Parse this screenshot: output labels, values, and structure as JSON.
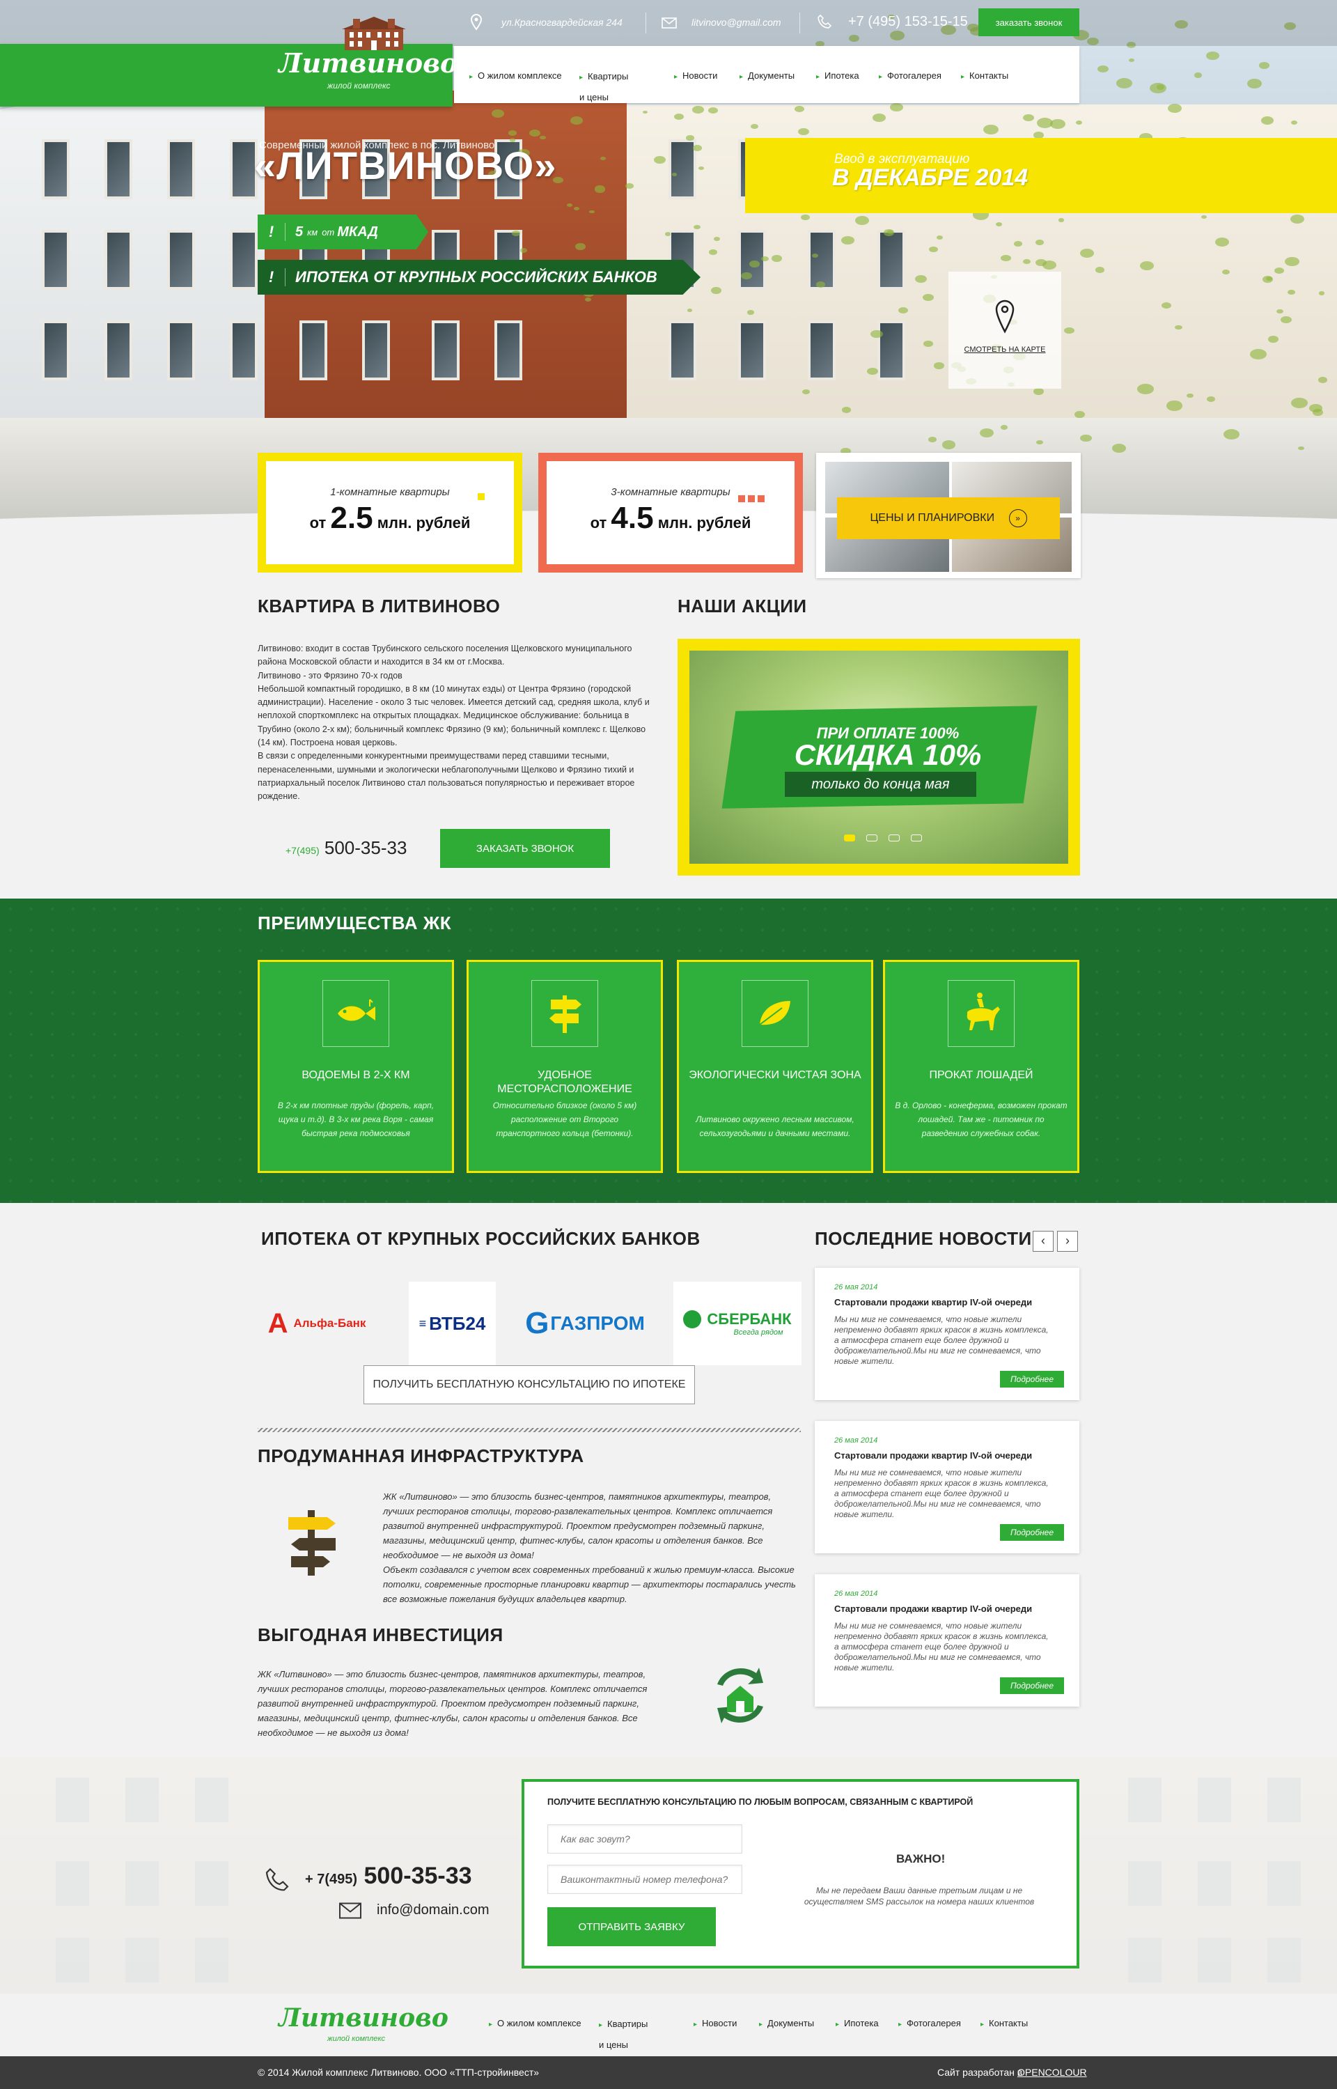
{
  "topbar": {
    "address": "ул.Красногвардейская 244",
    "email": "litvinovo@gmail.com",
    "phone": "+7 (495) 153-15-15",
    "call_button": "заказать звонок"
  },
  "logo": {
    "title": "Литвиново",
    "subtitle": "жилой комплекс"
  },
  "nav": [
    {
      "label": "О жилом комплексе"
    },
    {
      "label": "Квартиры и цены"
    },
    {
      "label": "Новости"
    },
    {
      "label": "Документы"
    },
    {
      "label": "Ипотека"
    },
    {
      "label": "Фотогалерея"
    },
    {
      "label": "Контакты"
    }
  ],
  "hero": {
    "subtitle": "Современный жилой комплекс в пос. Литвиново",
    "title": "«ЛИТВИНОВО»",
    "ribbon1": {
      "icon": "!",
      "num": "5",
      "km": "км",
      "ot": "от",
      "label": "МКАД"
    },
    "ribbon2": {
      "icon": "!",
      "label": "ИПОТЕКА ОТ КРУПНЫХ РОССИЙСКИХ БАНКОВ"
    },
    "commission_label": "Ввод в эксплуатацию",
    "commission_value": "В ДЕКАБРЕ 2014",
    "map_link": "СМОТРЕТЬ НА КАРТЕ"
  },
  "prices": [
    {
      "label": "1-комнатные квартиры",
      "from": "от",
      "value": "2.5",
      "unit": "млн. рублей",
      "accent": "#f7e400"
    },
    {
      "label": "3-комнатные квартиры",
      "from": "от",
      "value": "4.5",
      "unit": "млн. рублей",
      "accent": "#ef6a4f"
    }
  ],
  "plans_button": "ЦЕНЫ И ПЛАНИРОВКИ",
  "about": {
    "heading": "КВАРТИРА В ЛИТВИНОВО",
    "paragraphs": [
      "Литвиново: входит в состав Трубинского сельского поселения Щелковского муниципального района Московской области и находится в 34 км от г.Москва.",
      "Литвиново - это Фрязино 70-х годов",
      "Небольшой компактный городишко, в 8 км (10 минутах езды) от Центра Фрязино (городской администрации). Население - около 3 тыс человек. Имеется детский сад, средняя школа, клуб и неплохой спорткомплекс на открытых площадках. Медицинское обслуживание: больница в Трубино (около 2-х км); больничный комплекс Фрязино (9 км); больничный комплекс г. Щелково (14 км). Построена новая церковь.",
      "В связи с определенными конкурентными преимуществами перед ставшими тесными, перенаселенными, шумными и экологически неблагополучными Щелково и Фрязино тихий и патриархальный поселок Литвиново стал пользоваться популярностью и переживает второе рождение."
    ],
    "phone_prefix": "+7(495)",
    "phone": "500-35-33",
    "call_button": "ЗАКАЗАТЬ ЗВОНОК"
  },
  "promo": {
    "heading": "НАШИ АКЦИИ",
    "line1": "ПРИ ОПЛАТЕ 100%",
    "line2": "СКИДКА 10%",
    "line3": "только до конца мая"
  },
  "advantages": {
    "heading": "ПРЕИМУЩЕСТВА ЖК",
    "items": [
      {
        "title": "ВОДОЕМЫ В 2-Х КМ",
        "text": "В 2-х км плотные пруды (форель, карп, щука и т.д). В 3-х км река Воря - самая быстрая река подмосковья",
        "icon": "fish-icon"
      },
      {
        "title": "УДОБНОЕ МЕСТОРАСПОЛОЖЕНИЕ",
        "text": "Относительно близкое (около 5 км) расположение от Второго транспортного кольца (бетонки).",
        "icon": "signpost-icon"
      },
      {
        "title": "ЭКОЛОГИЧЕСКИ ЧИСТАЯ ЗОНА",
        "text": "Литвиново окружено лесным массивом, сельхозугодьями и дачными местами.",
        "icon": "leaf-icon"
      },
      {
        "title": "ПРОКАТ ЛОШАДЕЙ",
        "text": "В д. Орлово - конеферма, возможен прокат лошадей. Там же - питомник по разведению служебных собак.",
        "icon": "horse-rider-icon"
      }
    ]
  },
  "mortgage": {
    "heading": "ИПОТЕКА ОТ КРУПНЫХ РОССИЙСКИХ БАНКОВ",
    "banks": [
      {
        "name": "Альфа-Банк",
        "icon": "alfa-bank-logo"
      },
      {
        "name": "ВТБ24",
        "icon": "vtb24-logo"
      },
      {
        "name": "ГАЗПРОМ",
        "icon": "gazprom-logo"
      },
      {
        "name": "СБЕРБАНК",
        "tagline": "Всегда рядом",
        "icon": "sberbank-logo"
      }
    ],
    "consult_button": "ПОЛУЧИТЬ БЕСПЛАТНУЮ КОНСУЛЬТАЦИЮ ПО ИПОТЕКЕ"
  },
  "infrastructure": {
    "heading": "ПРОДУМАННАЯ ИНФРАСТРУКТУРА",
    "text": "ЖК «Литвиново» — это близость бизнес-центров, памятников архитектуры, театров, лучших ресторанов столицы, торгово-развлекательных центров. Комплекс отличается развитой внутренней инфраструктурой. Проектом предусмотрен подземный паркинг, магазины, медицинский центр, фитнес-клубы, салон красоты и отделения банков. Все необходимое — не выходя из дома!",
    "text2": "Объект создавался с учетом всех современных требований к жилью премиум-класса. Высокие потолки, современные просторные планировки квартир — архитекторы постарались учесть все возможные пожелания будущих владельцев квартир."
  },
  "investment": {
    "heading": "ВЫГОДНАЯ ИНВЕСТИЦИЯ",
    "text": "ЖК «Литвиново» — это близость бизнес-центров, памятников архитектуры, театров, лучших ресторанов столицы, торгово-развлекательных центров. Комплекс отличается развитой внутренней инфраструктурой. Проектом предусмотрен подземный паркинг, магазины, медицинский центр, фитнес-клубы, салон красоты и отделения банков. Все необходимое — не выходя из дома!"
  },
  "news": {
    "heading": "ПОСЛЕДНИЕ НОВОСТИ",
    "prev": "‹",
    "next": "›",
    "items": [
      {
        "date": "26 мая 2014",
        "title": "Стартовали продажи квартир IV-ой очереди",
        "body": "Мы ни миг не сомневаемся, что новые жители непременно добавят ярких красок в жизнь комплекса, а атмосфера станет еще более дружной и доброжелательной.Мы ни миг не сомневаемся, что новые жители.",
        "more": "Подробнее"
      },
      {
        "date": "26 мая 2014",
        "title": "Стартовали продажи квартир IV-ой очереди",
        "body": "Мы ни миг не сомневаемся, что новые жители непременно добавят ярких красок в жизнь комплекса, а атмосфера станет еще более дружной и доброжелательной.Мы ни миг не сомневаемся, что новые жители.",
        "more": "Подробнее"
      },
      {
        "date": "26 мая 2014",
        "title": "Стартовали продажи квартир IV-ой очереди",
        "body": "Мы ни миг не сомневаемся, что новые жители непременно добавят ярких красок в жизнь комплекса, а атмосфера станет еще более дружной и доброжелательной.Мы ни миг не сомневаемся, что новые жители.",
        "more": "Подробнее"
      }
    ]
  },
  "contact": {
    "phone_prefix": "+ 7(495)",
    "phone": "500-35-33",
    "email": "info@domain.com",
    "form_title": "ПОЛУЧИТЕ БЕСПЛАТНУЮ КОНСУЛЬТАЦИЮ ПО ЛЮБЫМ ВОПРОСАМ, СВЯЗАННЫМ С КВАРТИРОЙ",
    "name_placeholder": "Как вас зовут?",
    "phone_placeholder": "Вашконтактный номер телефона?",
    "submit": "ОТПРАВИТЬ ЗАЯВКУ",
    "important_title": "ВАЖНО!",
    "important_text": "Мы не передаем Ваши данные третьим лицам и не осуществляем SMS рассылок на номера наших клиентов"
  },
  "footer": {
    "copyright": "© 2014 Жилой комплекс Литвиново. ООО «ТТП-стройинвест»",
    "credit_label": "Сайт разработан в",
    "credit_link": "OPENCOLOUR"
  },
  "colors": {
    "brand_green": "#2fac36",
    "dark_green": "#1b6e2d",
    "yellow": "#f7e400",
    "coral": "#ef6a4f"
  }
}
